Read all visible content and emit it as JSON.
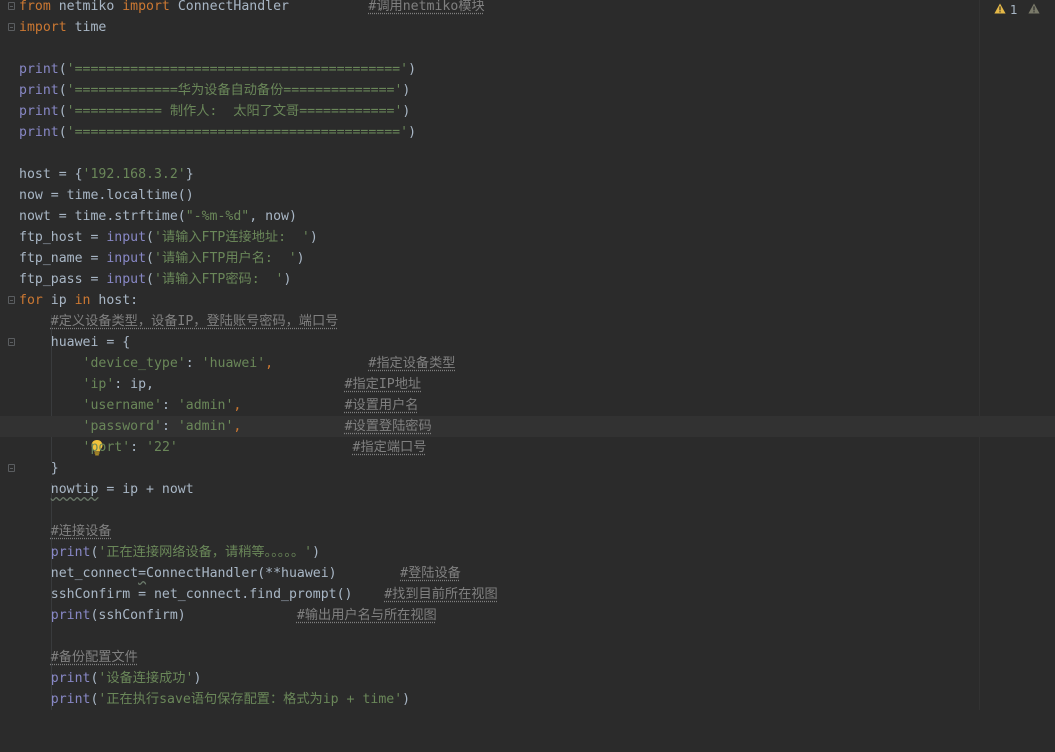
{
  "inspection": {
    "warning_count": "1"
  },
  "code_lines": {
    "l1": {
      "a": "from",
      "b": " netmiko ",
      "c": "import",
      "d": " ConnectHandler          ",
      "e": "#调用netmiko模块"
    },
    "l2": {
      "a": "import",
      "b": " time"
    },
    "l4": {
      "a": "print",
      "b": "(",
      "c": "'========================================='",
      "d": ")"
    },
    "l5": {
      "a": "print",
      "b": "(",
      "c": "'=============华为设备自动备份=============='",
      "d": ")"
    },
    "l6": {
      "a": "print",
      "b": "(",
      "c": "'=========== 制作人:  太阳了文哥============'",
      "d": ")"
    },
    "l7": {
      "a": "print",
      "b": "(",
      "c": "'========================================='",
      "d": ")"
    },
    "l9": {
      "a": "host = {",
      "b": "'192.168.3.2'",
      "c": "}"
    },
    "l10": {
      "a": "now = time.localtime()"
    },
    "l11": {
      "a": "nowt = time.strftime(",
      "b": "\"-%m-%d\"",
      "c": ", now)"
    },
    "l12": {
      "a": "ftp_host = ",
      "b": "input",
      "c": "(",
      "d": "'请输入FTP连接地址:  '",
      "e": ")"
    },
    "l13": {
      "a": "ftp_name = ",
      "b": "input",
      "c": "(",
      "d": "'请输入FTP用户名:  '",
      "e": ")"
    },
    "l14": {
      "a": "ftp_pass = ",
      "b": "input",
      "c": "(",
      "d": "'请输入FTP密码:  '",
      "e": ")"
    },
    "l15": {
      "a": "for",
      "b": " ip ",
      "c": "in",
      "d": " host:"
    },
    "l16": {
      "a": "    ",
      "b": "#定义设备类型，设备IP，登陆账号密码，端口号"
    },
    "l17": {
      "a": "    huawei = {"
    },
    "l18": {
      "a": "        ",
      "b": "'device_type'",
      "c": ": ",
      "d": "'huawei'",
      "e": ",            ",
      "f": "#指定设备类型"
    },
    "l19": {
      "a": "        ",
      "b": "'ip'",
      "c": ": ip,                        ",
      "d": "#指定IP地址"
    },
    "l20": {
      "a": "        ",
      "b": "'username'",
      "c": ": ",
      "d": "'admin'",
      "e": ",             ",
      "f": "#设置用户名"
    },
    "l21": {
      "a": "        ",
      "b": "'password'",
      "c": ": ",
      "d": "'admin'",
      "e": ",             ",
      "f": "#设置登陆密码"
    },
    "l22": {
      "a": "        ",
      "b": "'port'",
      "c": ": ",
      "d": "'22'",
      "e": "                      ",
      "f": "#指定端口号"
    },
    "l23": {
      "a": "    }"
    },
    "l24": {
      "a": "    ",
      "b": "nowtip",
      "c": " = ip + nowt"
    },
    "l26": {
      "a": "    ",
      "b": "#连接设备"
    },
    "l27": {
      "a": "    ",
      "b": "print",
      "c": "(",
      "d": "'正在连接网络设备，请稍等。。。。。'",
      "e": ")"
    },
    "l28": {
      "a": "    net_connect",
      "b": "=",
      "c": "ConnectHandler(**huawei)        ",
      "d": "#登陆设备"
    },
    "l29": {
      "a": "    sshConfirm = net_connect.find_prompt()    ",
      "b": "#找到目前所在视图"
    },
    "l30": {
      "a": "    ",
      "b": "print",
      "c": "(sshConfirm)              ",
      "d": "#输出用户名与所在视图"
    },
    "l32": {
      "a": "    ",
      "b": "#备份配置文件"
    },
    "l33": {
      "a": "    ",
      "b": "print",
      "c": "(",
      "d": "'设备连接成功'",
      "e": ")"
    },
    "l34": {
      "a": "    ",
      "b": "print",
      "c": "(",
      "d": "'正在执行save语句保存配置：格式为ip + time'",
      "e": ")"
    }
  }
}
